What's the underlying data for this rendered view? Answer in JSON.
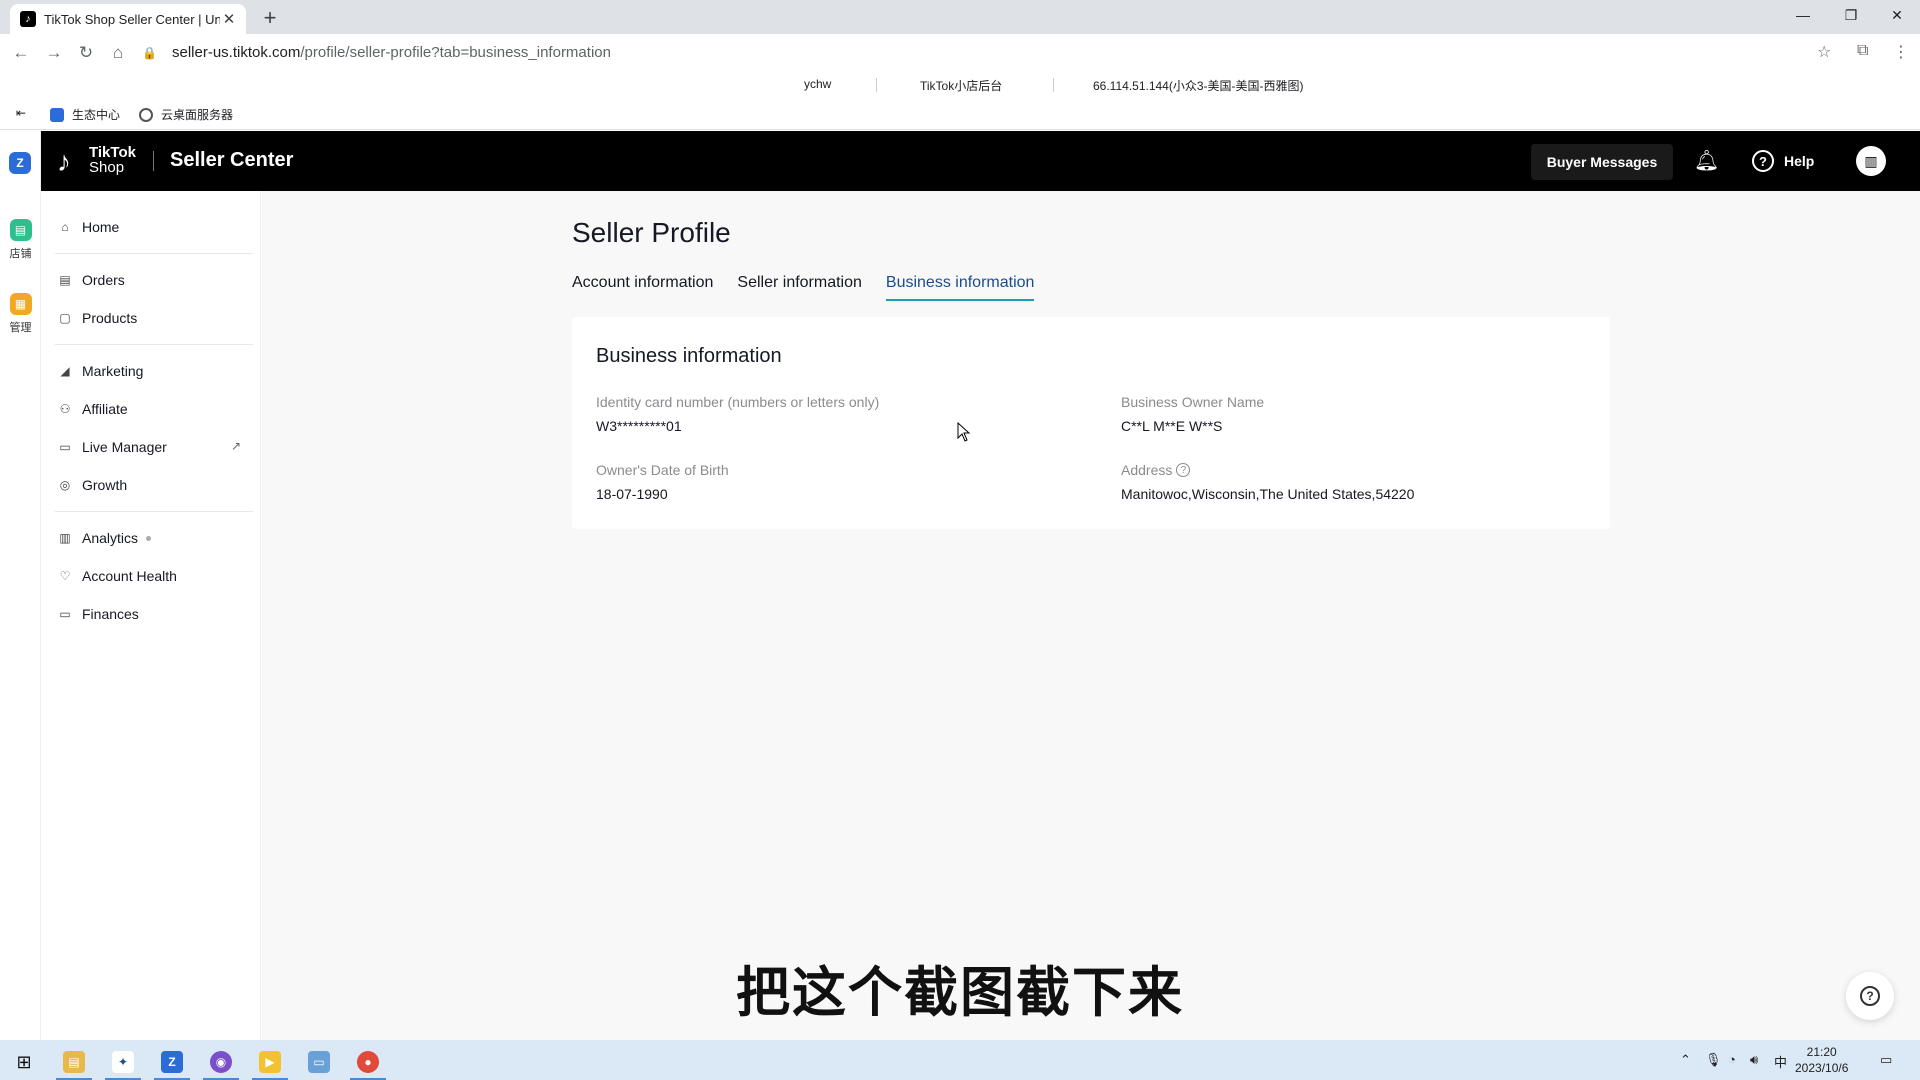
{
  "browser": {
    "tab_title": "TikTok Shop Seller Center | Un",
    "tab_favicon": "tiktok-icon",
    "url_host": "seller-us.tiktok.com",
    "url_path": "/profile/seller-profile?tab=business_information",
    "infobar": {
      "user": "ychw",
      "platform": "TikTok小店后台",
      "ip": "66.114.51.144(小众3-美国-美国-西雅图)"
    },
    "bookmarks": [
      "生态中心",
      "云桌面服务器"
    ]
  },
  "left_strip": {
    "items": [
      "店铺",
      "管理"
    ]
  },
  "header": {
    "logo_line1": "TikTok",
    "logo_line2": "Shop",
    "title": "Seller Center",
    "buyer_messages": "Buyer Messages",
    "help": "Help"
  },
  "sidebar": {
    "items": [
      {
        "label": "Home",
        "icon": "home-icon"
      },
      {
        "label": "Orders",
        "icon": "orders-icon"
      },
      {
        "label": "Products",
        "icon": "products-icon"
      },
      {
        "label": "Marketing",
        "icon": "megaphone-icon"
      },
      {
        "label": "Affiliate",
        "icon": "people-icon"
      },
      {
        "label": "Live Manager",
        "icon": "live-icon"
      },
      {
        "label": "Growth",
        "icon": "growth-icon"
      },
      {
        "label": "Analytics",
        "icon": "chart-icon"
      },
      {
        "label": "Account Health",
        "icon": "shield-icon"
      },
      {
        "label": "Finances",
        "icon": "wallet-icon"
      }
    ]
  },
  "page": {
    "title": "Seller Profile",
    "tabs": [
      "Account information",
      "Seller information",
      "Business information"
    ],
    "active_tab": "Business information",
    "card": {
      "title": "Business information",
      "id_label": "Identity card number (numbers or letters only)",
      "id_value": "W3*********01",
      "owner_label": "Business Owner Name",
      "owner_value": "C**L M**E W**S",
      "dob_label": "Owner's Date of Birth",
      "dob_value": "18-07-1990",
      "address_label": "Address",
      "address_value": "Manitowoc,Wisconsin,The United States,54220"
    }
  },
  "overlay_subtitle": "把这个截图截下来",
  "taskbar": {
    "ime": "中",
    "time": "21:20",
    "date": "2023/10/6"
  },
  "colors": {
    "header_bg": "#000000",
    "active_tab": "#1a9fb0",
    "main_bg": "#f8f8f8"
  }
}
